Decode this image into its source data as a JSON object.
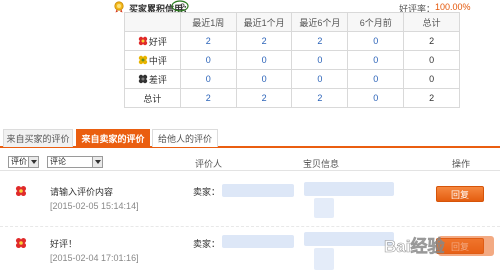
{
  "credit": {
    "label": "买家累积信用：",
    "value": "2",
    "rate_label": "好评率：",
    "rate_value": "100.00%"
  },
  "stats": {
    "headers": [
      "",
      "最近1周",
      "最近1个月",
      "最近6个月",
      "6个月前",
      "总计"
    ],
    "rows": [
      {
        "label": "好评",
        "icon": "red-flower-icon",
        "values": [
          "2",
          "2",
          "2",
          "0",
          "2"
        ]
      },
      {
        "label": "中评",
        "icon": "yellow-flower-icon",
        "values": [
          "0",
          "0",
          "0",
          "0",
          "0"
        ]
      },
      {
        "label": "差评",
        "icon": "black-flower-icon",
        "values": [
          "0",
          "0",
          "0",
          "0",
          "0"
        ]
      },
      {
        "label": "总计",
        "icon": "",
        "values": [
          "2",
          "2",
          "2",
          "0",
          "2"
        ]
      }
    ]
  },
  "tabs": [
    {
      "label": "来自买家的评价",
      "active": false
    },
    {
      "label": "来自卖家的评价",
      "active": true
    },
    {
      "label": "给他人的评价",
      "active": false
    }
  ],
  "filters": {
    "rating_select": "评价",
    "comment_select": "评论",
    "col_reviewer": "评价人",
    "col_item": "宝贝信息",
    "col_action": "操作"
  },
  "reviews": [
    {
      "content": "请输入评价内容",
      "date": "[2015-02-05 15:14:14]",
      "seller_label": "卖家：",
      "action": "回复"
    },
    {
      "content": "好评！",
      "date": "[2015-02-04 17:01:16]",
      "seller_label": "卖家：",
      "action": "回复"
    }
  ],
  "colors": {
    "accent": "#ea5e10",
    "link_blue": "#2a62b8",
    "rate_orange": "#e4570a",
    "redacted_blue": "#dde7f7"
  },
  "watermark": "Bai经验"
}
